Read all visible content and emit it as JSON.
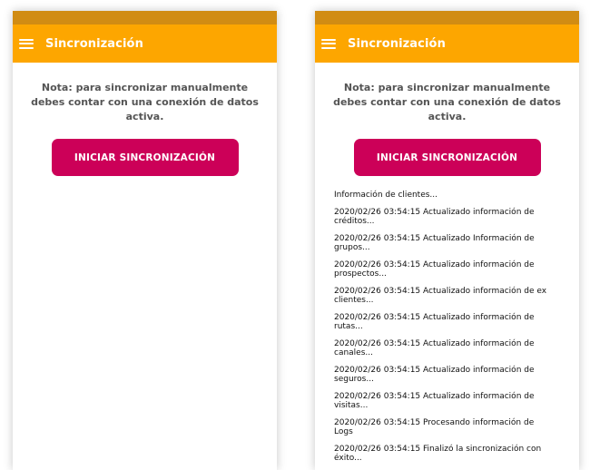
{
  "screens": [
    {
      "app_bar": {
        "title": "Sincronización"
      },
      "note": "Nota: para sincronizar manualmente debes contar con una conexión de datos activa.",
      "sync_button": "INICIAR SINCRONIZACIÓN",
      "log": []
    },
    {
      "app_bar": {
        "title": "Sincronización"
      },
      "note": "Nota: para sincronizar manualmente debes contar con una conexión de datos activa.",
      "sync_button": "INICIAR SINCRONIZACIÓN",
      "log": [
        "Información de clientes...",
        "2020/02/26 03:54:15 Actualizado información de créditos...",
        "2020/02/26 03:54:15 Actualizado Información de grupos...",
        "2020/02/26 03:54:15 Actualizado información de prospectos...",
        "2020/02/26 03:54:15 Actualizado información de ex clientes...",
        "2020/02/26 03:54:15 Actualizado información de rutas...",
        "2020/02/26 03:54:15 Actualizado información de canales...",
        "2020/02/26 03:54:15 Actualizado información de seguros...",
        "2020/02/26 03:54:15 Actualizado información de visitas...",
        "2020/02/26 03:54:15 Procesando información de Logs",
        "2020/02/26 03:54:15 Finalizó la sincronización con éxito..."
      ]
    }
  ]
}
